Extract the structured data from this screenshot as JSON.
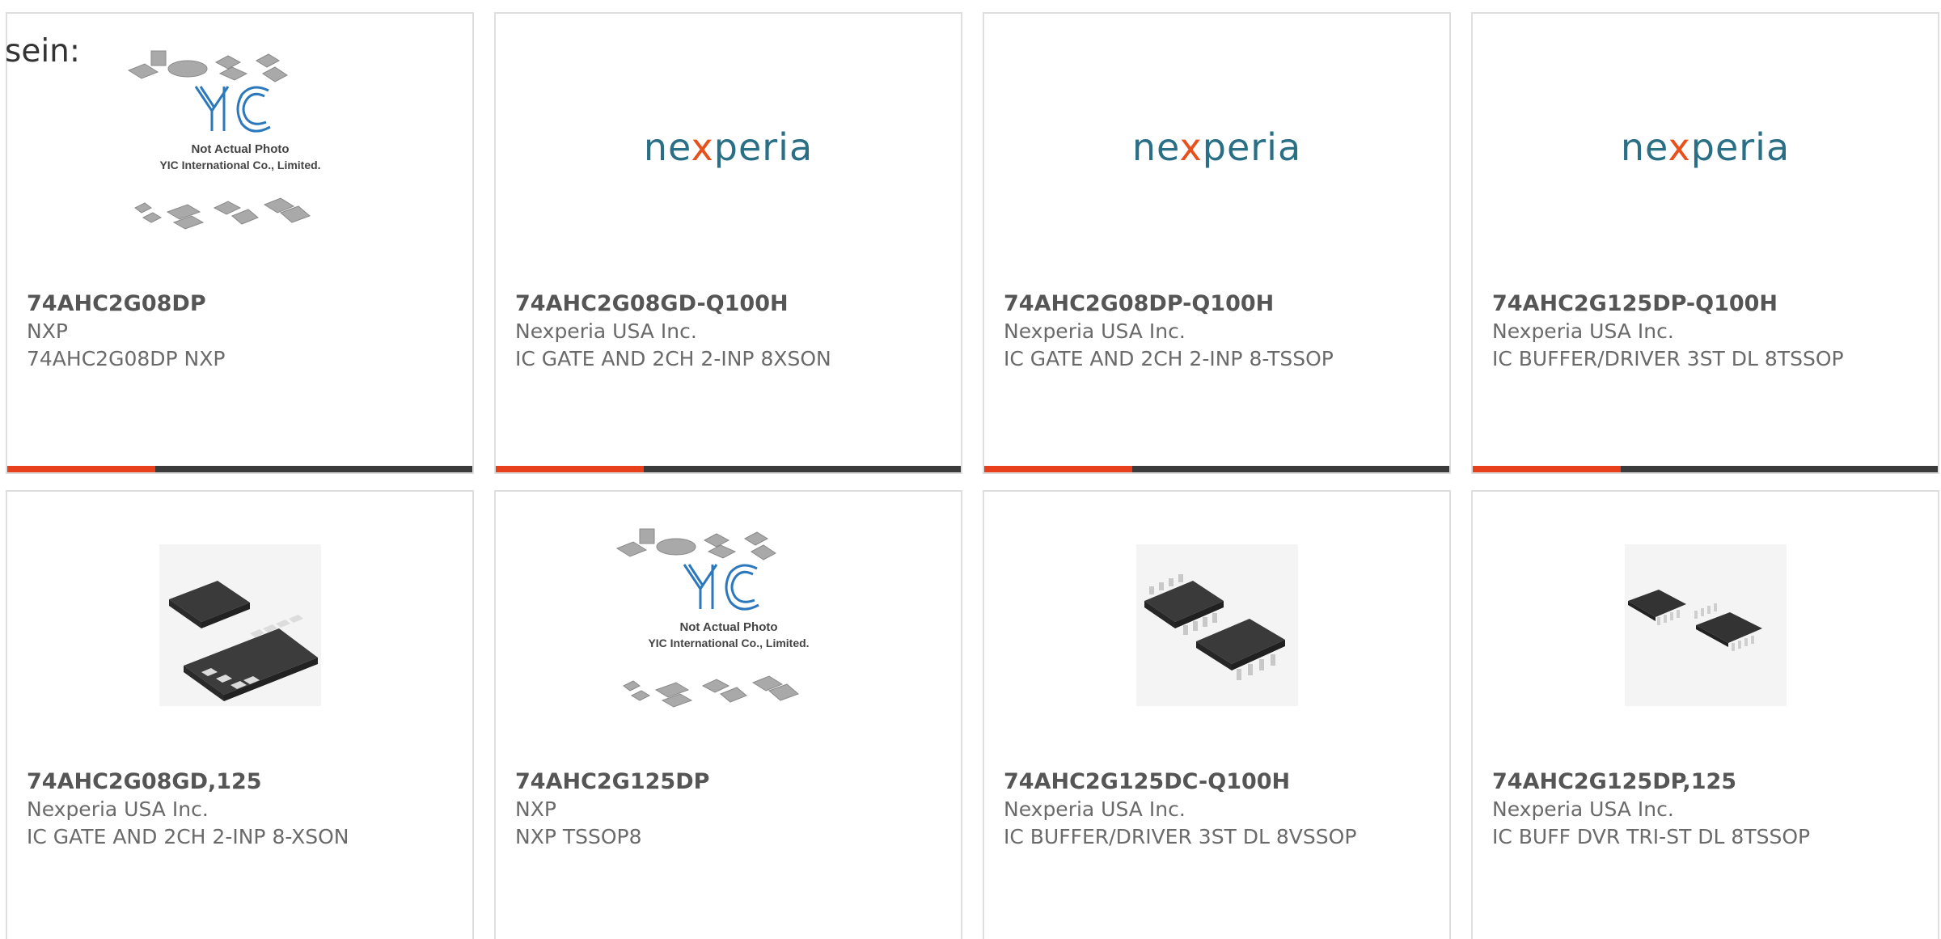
{
  "lead": {
    "text": "sein:"
  },
  "products": [
    {
      "part": "74AHC2G08DP",
      "manufacturer": "NXP",
      "description": "74AHC2G08DP NXP",
      "image": "yic-placeholder",
      "placeholder": {
        "line1": "Not Actual Photo",
        "line2": "YIC International Co., Limited."
      }
    },
    {
      "part": "74AHC2G08GD-Q100H",
      "manufacturer": "Nexperia USA Inc.",
      "description": "IC GATE AND 2CH 2-INP 8XSON",
      "image": "nexperia-logo",
      "logo": {
        "pre": "ne",
        "x": "x",
        "post": "peria"
      }
    },
    {
      "part": "74AHC2G08DP-Q100H",
      "manufacturer": "Nexperia USA Inc.",
      "description": "IC GATE AND 2CH 2-INP 8-TSSOP",
      "image": "nexperia-logo",
      "logo": {
        "pre": "ne",
        "x": "x",
        "post": "peria"
      }
    },
    {
      "part": "74AHC2G125DP-Q100H",
      "manufacturer": "Nexperia USA Inc.",
      "description": "IC BUFFER/DRIVER 3ST DL 8TSSOP",
      "image": "nexperia-logo",
      "logo": {
        "pre": "ne",
        "x": "x",
        "post": "peria"
      }
    },
    {
      "part": "74AHC2G08GD,125",
      "manufacturer": "Nexperia USA Inc.",
      "description": "IC GATE AND 2CH 2-INP 8-XSON",
      "image": "xson-chip-photo"
    },
    {
      "part": "74AHC2G125DP",
      "manufacturer": "NXP",
      "description": "NXP TSSOP8",
      "image": "yic-placeholder",
      "placeholder": {
        "line1": "Not Actual Photo",
        "line2": "YIC International Co., Limited."
      }
    },
    {
      "part": "74AHC2G125DC-Q100H",
      "manufacturer": "Nexperia USA Inc.",
      "description": "IC BUFFER/DRIVER 3ST DL 8VSSOP",
      "image": "vssop-chip-photo"
    },
    {
      "part": "74AHC2G125DP,125",
      "manufacturer": "Nexperia USA Inc.",
      "description": "IC BUFF DVR TRI-ST DL 8TSSOP",
      "image": "tssop-chip-photo"
    }
  ],
  "colors": {
    "accent": "#e8401c",
    "bar": "#3b3b3b",
    "logo_teal": "#2a6f86",
    "logo_orange": "#e8501c"
  }
}
